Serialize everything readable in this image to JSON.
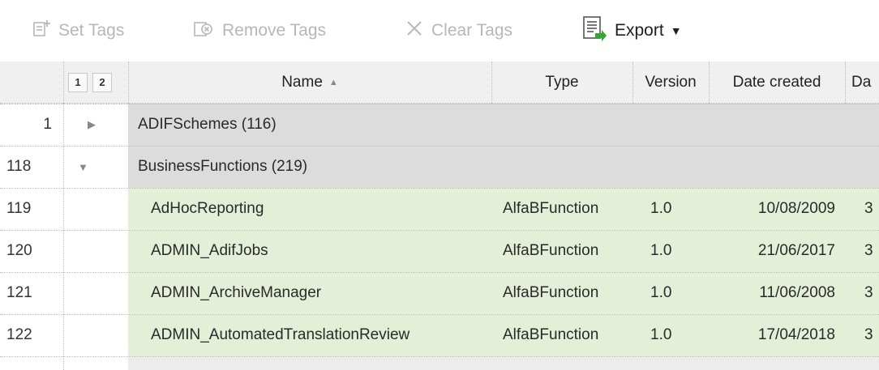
{
  "toolbar": {
    "set_tags": "Set Tags",
    "remove_tags": "Remove Tags",
    "clear_tags": "Clear Tags",
    "export": "Export"
  },
  "grid": {
    "level_buttons": [
      "1",
      "2"
    ],
    "columns": {
      "name": "Name",
      "type": "Type",
      "version": "Version",
      "date_created": "Date created",
      "date_modified_partial": "Da"
    },
    "groups": [
      {
        "row": "1",
        "label": "ADIFSchemes (116)",
        "expanded": false
      },
      {
        "row": "118",
        "label": "BusinessFunctions (219)",
        "expanded": true
      }
    ],
    "rows": [
      {
        "num": "119",
        "name": "AdHocReporting",
        "type": "AlfaBFunction",
        "version": "1.0",
        "date": "10/08/2009",
        "next": "3"
      },
      {
        "num": "120",
        "name": "ADMIN_AdifJobs",
        "type": "AlfaBFunction",
        "version": "1.0",
        "date": "21/06/2017",
        "next": "3"
      },
      {
        "num": "121",
        "name": "ADMIN_ArchiveManager",
        "type": "AlfaBFunction",
        "version": "1.0",
        "date": "11/06/2008",
        "next": "3"
      },
      {
        "num": "122",
        "name": "ADMIN_AutomatedTranslationReview",
        "type": "AlfaBFunction",
        "version": "1.0",
        "date": "17/04/2018",
        "next": "3"
      }
    ]
  },
  "colors": {
    "group_row": "#dcdcdc",
    "child_row": "#e4efd8",
    "header": "#f0f0f0",
    "disabled_text": "#b7b7b7"
  }
}
